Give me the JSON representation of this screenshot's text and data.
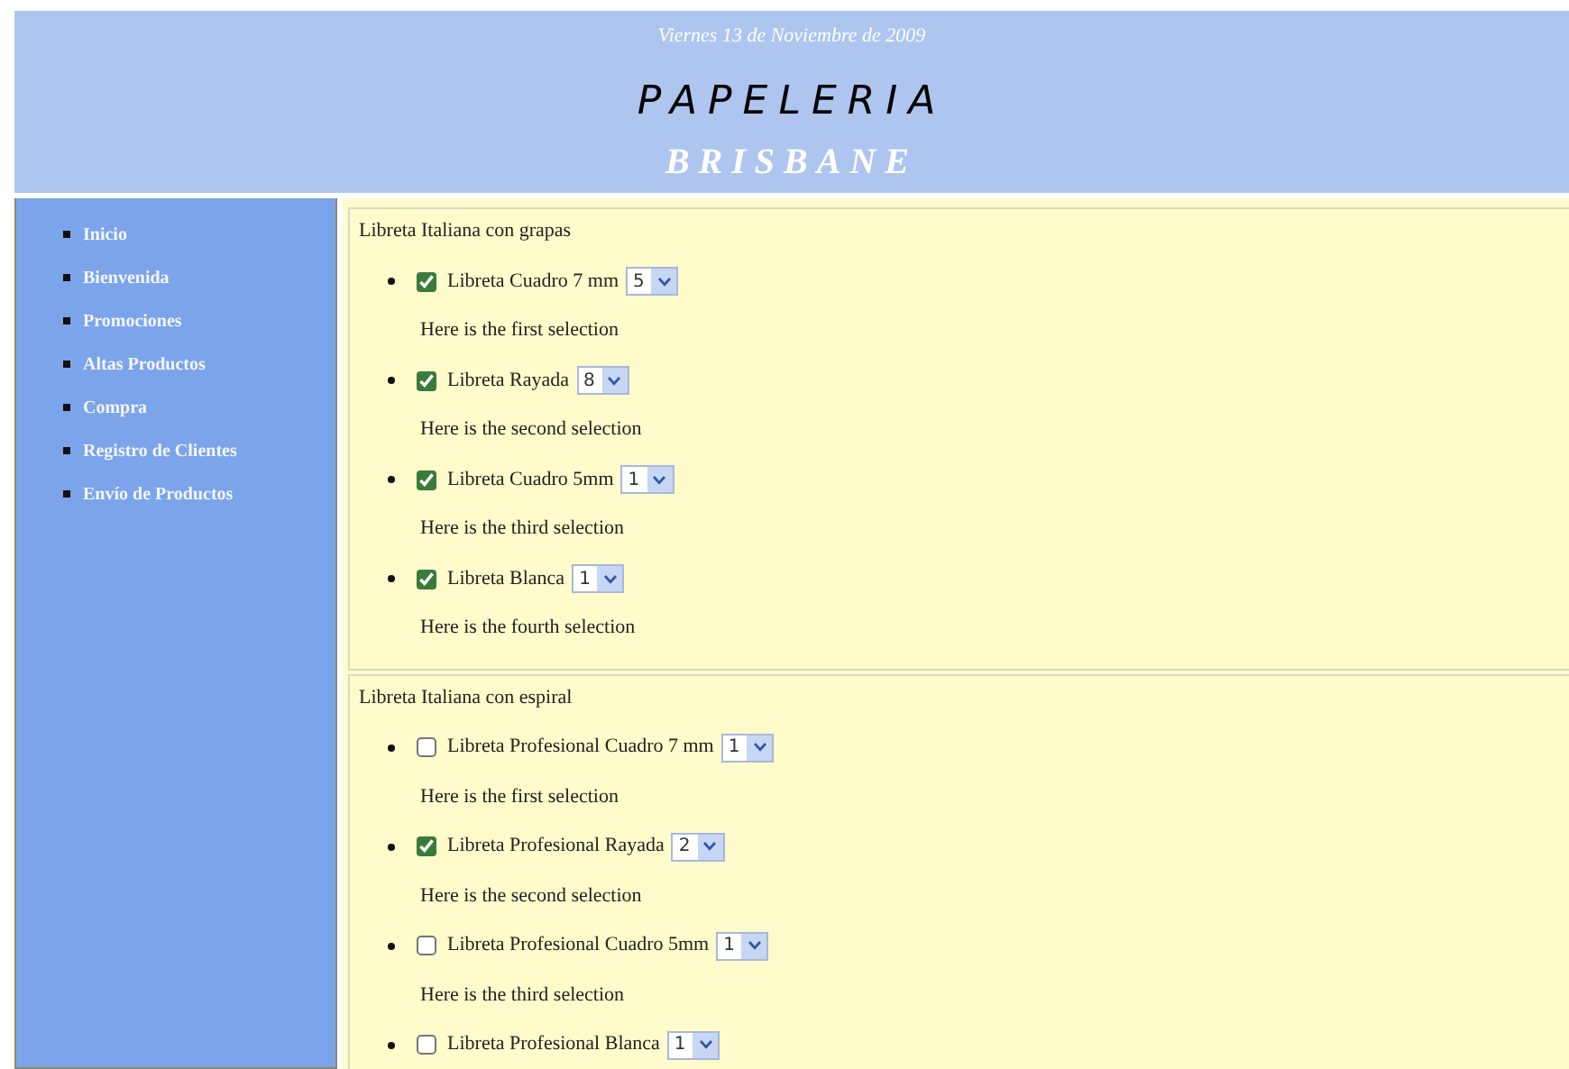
{
  "header": {
    "date": "Viernes 13 de Noviembre de 2009",
    "title": "PAPELERIA",
    "subtitle": "BRISBANE"
  },
  "sidebar": {
    "items": [
      {
        "label": "Inicio"
      },
      {
        "label": "Bienvenida"
      },
      {
        "label": "Promociones"
      },
      {
        "label": "Altas Productos"
      },
      {
        "label": "Compra"
      },
      {
        "label": "Registro de Clientes"
      },
      {
        "label": "Envío de Productos"
      }
    ]
  },
  "groups": [
    {
      "legend": "Libreta Italiana con grapas",
      "items": [
        {
          "label": "Libreta Cuadro 7 mm",
          "checked": true,
          "quantity": "5",
          "note": "Here is the first selection"
        },
        {
          "label": "Libreta Rayada",
          "checked": true,
          "quantity": "8",
          "note": "Here is the second selection"
        },
        {
          "label": "Libreta Cuadro 5mm",
          "checked": true,
          "quantity": "1",
          "note": "Here is the third selection"
        },
        {
          "label": "Libreta Blanca",
          "checked": true,
          "quantity": "1",
          "note": "Here is the fourth selection"
        }
      ]
    },
    {
      "legend": "Libreta Italiana con espiral",
      "items": [
        {
          "label": "Libreta Profesional Cuadro 7 mm",
          "checked": false,
          "quantity": "1",
          "note": "Here is the first selection"
        },
        {
          "label": "Libreta Profesional Rayada",
          "checked": true,
          "quantity": "2",
          "note": "Here is the second selection"
        },
        {
          "label": "Libreta Profesional Cuadro 5mm",
          "checked": false,
          "quantity": "1",
          "note": "Here is the third selection"
        },
        {
          "label": "Libreta Profesional Blanca",
          "checked": false,
          "quantity": "1"
        }
      ]
    }
  ]
}
